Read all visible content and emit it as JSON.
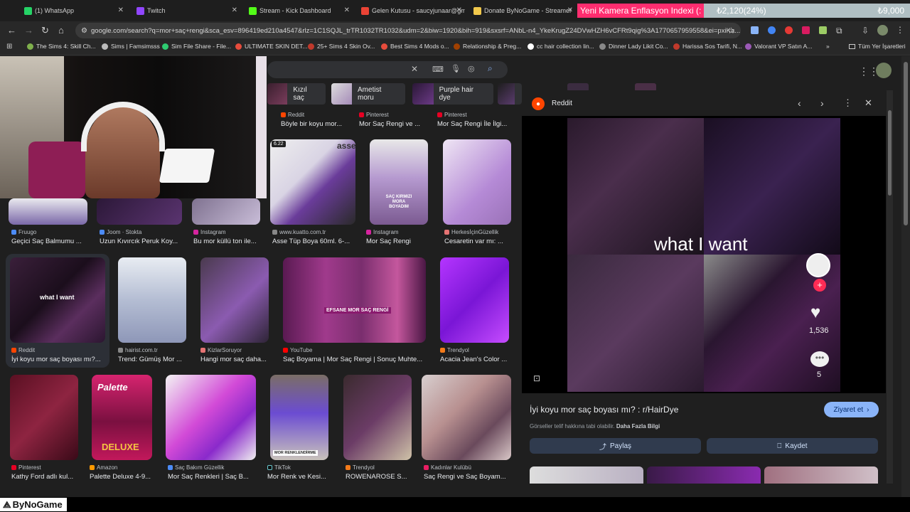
{
  "tabs": [
    {
      "label": "(1) WhatsApp",
      "color": "#25d366"
    },
    {
      "label": "Twitch",
      "color": "#9146ff"
    },
    {
      "label": "Stream - Kick Dashboard",
      "color": "#53fc18"
    },
    {
      "label": "Gelen Kutusu - saucyjunaar@gm",
      "color": "#ea4335"
    },
    {
      "label": "Donate ByNoGame - Streamer",
      "color": "#f2c94c"
    }
  ],
  "ticker": {
    "headline": "Yeni Kamera Enflasyon Indexi (:",
    "value1": "₺2,120(24%)",
    "value2": "₺9,000"
  },
  "url": "google.com/search?q=mor+saç+rengi&sca_esv=896419ed210a4547&rlz=1C1SQJL_trTR1032TR1032&udm=2&biw=1920&bih=919&sxsrf=ANbL-n4_YkeKrugZ24DVwHZH6vCFRt9qig%3A1770657959558&ei=pxiKa...",
  "bookmarks": [
    "The Sims 4: Skill Ch...",
    "Sims | Famsimsss",
    "Sim File Share - File...",
    "ULTIMATE SKIN DET...",
    "25+ Sims 4 Skin Ov...",
    "Best Sims 4 Mods o...",
    "Relationship & Preg...",
    "cc hair collection lin...",
    "Dinner Lady Likit Co...",
    "Harissa Sos Tarifi, N...",
    "Valorant VP Satın A...",
    "»",
    "Tüm Yer İşaretleri"
  ],
  "chips": [
    "Kızıl saç",
    "Ametist moru",
    "Purple hair dye"
  ],
  "row0": [
    {
      "src": "Reddit",
      "title": "Böyle bir koyu mor..."
    },
    {
      "src": "Pinterest",
      "title": "Mor Saç Rengi ve ..."
    },
    {
      "src": "Pinterest",
      "title": "Mor Saç Rengi İle İlgi..."
    }
  ],
  "row1": [
    {
      "src": "Fruugo",
      "title": "Geçici Saç Balmumu ..."
    },
    {
      "src": "Joom · Stokta",
      "title": "Uzun Kıvırcık Peruk Koy..."
    },
    {
      "src": "Instagram",
      "title": "Bu mor küllü ton ile..."
    },
    {
      "src": "www.kuatto.com.tr",
      "title": "Asse Tüp Boya 60ml. 6-..."
    },
    {
      "src": "Instagram",
      "title": "Mor Saç Rengi"
    },
    {
      "src": "HerkesİçinGüzellik",
      "title": "Cesaretin var mı: ..."
    }
  ],
  "row2": [
    {
      "src": "Reddit",
      "title": "İyi koyu mor saç boyası mı?..."
    },
    {
      "src": "hairist.com.tr",
      "title": "Trend: Gümüş Mor ..."
    },
    {
      "src": "KizlarSoruyor",
      "title": "Hangi mor saç daha..."
    },
    {
      "src": "YouTube",
      "title": "Saç Boyama | Mor Saç Rengi | Sonuç Muhte..."
    },
    {
      "src": "Trendyol",
      "title": "Acacia Jean's Color ..."
    }
  ],
  "row3": [
    {
      "src": "Pinterest",
      "title": "Kathy Ford adlı kul..."
    },
    {
      "src": "Amazon",
      "title": "Palette Deluxe 4-9..."
    },
    {
      "src": "Saç Bakım Güzellik",
      "title": "Mor Saç Renkleri | Saç B..."
    },
    {
      "src": "TikTok",
      "title": "Mor Renk ve Kesi..."
    },
    {
      "src": "Trendyol",
      "title": "ROWENAROSE S..."
    },
    {
      "src": "Kadınlar Kulübü",
      "title": "Saç Rengi ve Saç Boyam..."
    }
  ],
  "thumb_labels": {
    "what_i_want": "what I want",
    "asse_badge": "6.22",
    "asse_brand": "asse",
    "mor_boya": "SAÇ KIRMIZI MORA BOYADIM",
    "efsane": "EFSANE MOR SAÇ RENGİ",
    "palette": "Palette",
    "deluxe": "DELUXE",
    "renk": "MOR RENKLENDİRME"
  },
  "panel": {
    "source": "Reddit",
    "overlay_text": "what I want",
    "likes": "1,536",
    "comments": "5",
    "title": "İyi koyu mor saç boyası mı? : r/HairDye",
    "visit": "Ziyaret et",
    "copyright": "Görseller telif hakkına tabi olabilir.",
    "more_info": "Daha Fazla Bilgi",
    "share": "Paylaş",
    "save": "Kaydet"
  },
  "footer_logo": "ByNoGame"
}
